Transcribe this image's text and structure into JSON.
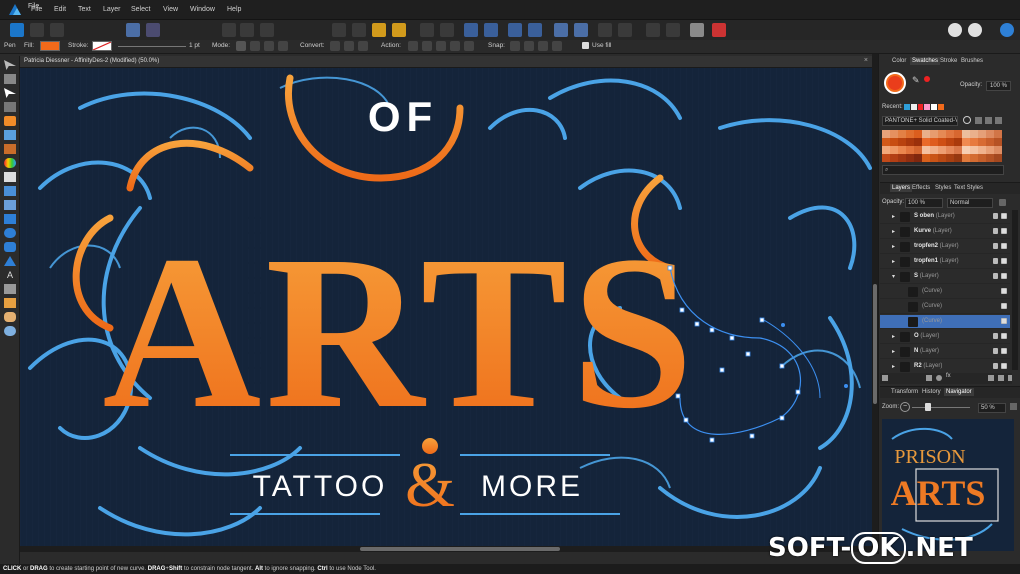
{
  "menubar": {
    "items": [
      "File",
      "Edit",
      "Text",
      "Layer",
      "Select",
      "View",
      "Window",
      "Help"
    ]
  },
  "context_bar": {
    "tool_name": "Pen",
    "fill_label": "Fill:",
    "stroke_label": "Stroke:",
    "stroke_width": "1 pt",
    "mode_label": "Mode:",
    "convert_label": "Convert:",
    "action_label": "Action:",
    "snap_label": "Snap:",
    "use_fill_label": "Use fill",
    "use_fill_checked": true,
    "fill_color": "#f26a1b"
  },
  "document": {
    "tab_title": "Patricia Diessner - AffinityDes-2 (Modified) (50.0%)"
  },
  "artwork": {
    "word_of": "OF",
    "word_arts": "ARTS",
    "word_tattoo": "TATTOO",
    "ampersand": "&",
    "word_more": "MORE",
    "color_orange": "#f47b20",
    "color_blue": "#4aa3e6",
    "color_bg": "#14243a"
  },
  "panel": {
    "color_tabs": [
      "Color",
      "Swatches",
      "Stroke",
      "Brushes"
    ],
    "active_color_tab": "Swatches",
    "opacity_label": "Opacity:",
    "opacity_value": "100 %",
    "recent_label": "Recent:",
    "palette_name": "PANTONE+ Solid Coated-V",
    "layer_tabs": [
      "Layers",
      "Effects",
      "Styles",
      "Text Styles"
    ],
    "active_layer_tab": "Layers",
    "layers_opacity_label": "Opacity:",
    "layers_opacity_value": "100 %",
    "blend_mode": "Normal",
    "layers": [
      {
        "name": "S oben",
        "type": "(Layer)",
        "bold": true,
        "selected": false,
        "indent": 0
      },
      {
        "name": "Kurve",
        "type": "(Layer)",
        "bold": true,
        "selected": false,
        "indent": 0
      },
      {
        "name": "tropfen2",
        "type": "(Layer)",
        "bold": true,
        "selected": false,
        "indent": 0
      },
      {
        "name": "tropfen1",
        "type": "(Layer)",
        "bold": true,
        "selected": false,
        "indent": 0
      },
      {
        "name": "S",
        "type": "(Layer)",
        "bold": true,
        "selected": false,
        "indent": 0,
        "expanded": true
      },
      {
        "name": "",
        "type": "(Curve)",
        "bold": false,
        "selected": false,
        "indent": 1
      },
      {
        "name": "",
        "type": "(Curve)",
        "bold": false,
        "selected": false,
        "indent": 1
      },
      {
        "name": "",
        "type": "(Curve)",
        "bold": false,
        "selected": true,
        "indent": 1
      },
      {
        "name": "O",
        "type": "(Layer)",
        "bold": true,
        "selected": false,
        "indent": 0
      },
      {
        "name": "N",
        "type": "(Layer)",
        "bold": true,
        "selected": false,
        "indent": 0
      },
      {
        "name": "R2",
        "type": "(Layer)",
        "bold": true,
        "selected": false,
        "indent": 0
      }
    ],
    "nav_tabs": [
      "Transform",
      "History",
      "Navigator"
    ],
    "active_nav_tab": "Navigator",
    "zoom_label": "Zoom:",
    "zoom_value": "50 %",
    "navigator_preview_text_1": "PRISON",
    "navigator_preview_text_2": "ARTS"
  },
  "status_bar": {
    "k1": "CLICK",
    "t1": " or ",
    "k2": "DRAG",
    "t2": " to create starting point of new curve. ",
    "k3": "DRAG",
    "t3": "+",
    "k4": "Shift",
    "t4": " to constrain node tangent. ",
    "k5": "Alt",
    "t5": " to ignore snapping. ",
    "k6": "Ctrl",
    "t6": " to use Node Tool."
  },
  "watermark": {
    "prefix": "SOFT-",
    "ok": "OK",
    "suffix": ".NET"
  }
}
